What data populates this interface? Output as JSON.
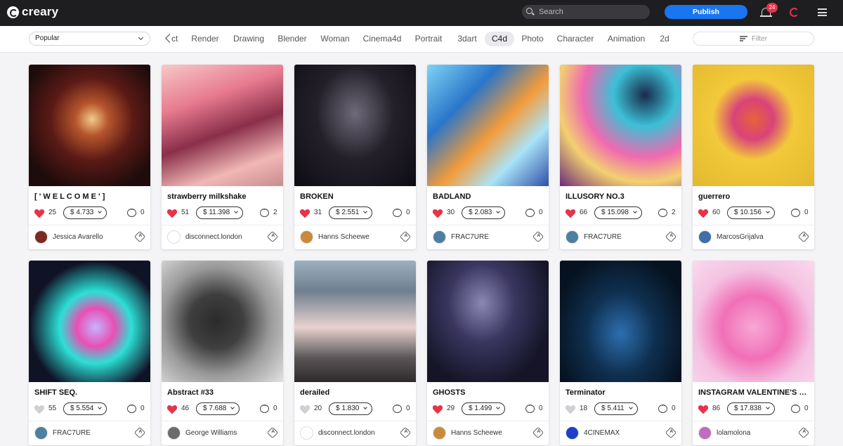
{
  "header": {
    "logo_text": "creary",
    "search_placeholder": "Search",
    "publish_label": "Publish",
    "notification_count": "24"
  },
  "filterbar": {
    "sort_value": "Popular",
    "partial_tab": "ct",
    "tabs": [
      "Render",
      "Drawing",
      "Blender",
      "Woman",
      "Cinema4d",
      "Portrait",
      "3dart",
      "C4d",
      "Photo",
      "Character",
      "Animation",
      "2d"
    ],
    "active_tab": "C4d",
    "filter_placeholder": "Filter"
  },
  "colors": {
    "accent": "#1976f0",
    "heart_liked": "#e6334a",
    "heart_unliked": "#cfcfd4",
    "topbar": "#1e1e20"
  },
  "cards": [
    {
      "title": "[ ' W E L C O M E ' ]",
      "likes": "25",
      "price": "$ 4.733",
      "comments": "0",
      "author": "Jessica Avarello",
      "liked": true
    },
    {
      "title": "strawberry milkshake",
      "likes": "51",
      "price": "$ 11.398",
      "comments": "2",
      "author": "disconnect.london",
      "liked": true
    },
    {
      "title": "BROKEN",
      "likes": "31",
      "price": "$ 2.551",
      "comments": "0",
      "author": "Hanns Scheewe",
      "liked": true
    },
    {
      "title": "BADLAND",
      "likes": "30",
      "price": "$ 2.083",
      "comments": "0",
      "author": "FRAC7URE",
      "liked": true
    },
    {
      "title": "ILLUSORY NO.3",
      "likes": "66",
      "price": "$ 15.098",
      "comments": "2",
      "author": "FRAC7URE",
      "liked": true
    },
    {
      "title": "guerrero",
      "likes": "60",
      "price": "$ 10.156",
      "comments": "0",
      "author": "MarcosGrijalva",
      "liked": true
    },
    {
      "title": "SHIFT SEQ.",
      "likes": "55",
      "price": "$ 5.554",
      "comments": "0",
      "author": "FRAC7URE",
      "liked": false
    },
    {
      "title": "Abstract #33",
      "likes": "46",
      "price": "$ 7.688",
      "comments": "0",
      "author": "George Williams",
      "liked": true
    },
    {
      "title": "derailed",
      "likes": "20",
      "price": "$ 1.830",
      "comments": "0",
      "author": "disconnect.london",
      "liked": false
    },
    {
      "title": "GHOSTS",
      "likes": "29",
      "price": "$ 1.499",
      "comments": "0",
      "author": "Hanns Scheewe",
      "liked": true
    },
    {
      "title": "Terminator",
      "likes": "18",
      "price": "$ 5.411",
      "comments": "0",
      "author": "4CINEMAX",
      "liked": false
    },
    {
      "title": "INSTAGRAM VALENTINE'S D...",
      "likes": "86",
      "price": "$ 17.838",
      "comments": "0",
      "author": "lolamolona",
      "liked": true
    }
  ]
}
